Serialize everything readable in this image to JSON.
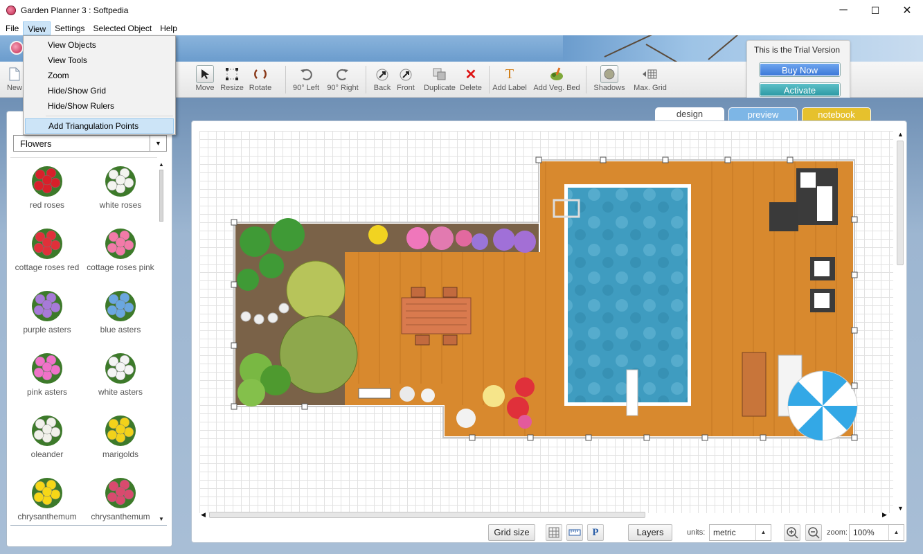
{
  "window": {
    "title": "Garden Planner 3 : Softpedia",
    "minimize": "─",
    "maximize": "☐",
    "close": "✕"
  },
  "menubar": {
    "items": [
      "File",
      "View",
      "Settings",
      "Selected Object",
      "Help"
    ],
    "active": "View"
  },
  "view_menu": {
    "items": [
      "View Objects",
      "View Tools",
      "Zoom",
      "Hide/Show Grid",
      "Hide/Show Rulers",
      "Add Triangulation Points"
    ],
    "highlighted": "Add Triangulation Points"
  },
  "toolbar": {
    "items": [
      "New",
      "Move",
      "Resize",
      "Rotate",
      "90° Left",
      "90° Right",
      "Back",
      "Front",
      "Duplicate",
      "Delete",
      "Add Label",
      "Add Veg. Bed",
      "Shadows",
      "Max. Grid"
    ]
  },
  "trial": {
    "text": "This is the Trial Version",
    "buy_label": "Buy Now",
    "activate_label": "Activate"
  },
  "tabs": [
    "design",
    "preview",
    "notebook"
  ],
  "left_panel": {
    "category": "Flowers",
    "plants": [
      {
        "name": "red roses",
        "color": "#d8202a"
      },
      {
        "name": "white roses",
        "color": "#f4f4f0"
      },
      {
        "name": "cottage roses red",
        "color": "#e0303a"
      },
      {
        "name": "cottage roses pink",
        "color": "#f27aa8"
      },
      {
        "name": "purple asters",
        "color": "#a77ad8"
      },
      {
        "name": "blue asters",
        "color": "#6aa7e0"
      },
      {
        "name": "pink asters",
        "color": "#f072c8"
      },
      {
        "name": "white asters",
        "color": "#f4f4f4"
      },
      {
        "name": "oleander",
        "color": "#f1f1ea"
      },
      {
        "name": "marigolds",
        "color": "#f2d21a"
      },
      {
        "name": "chrysanthemum",
        "color": "#f6d717"
      },
      {
        "name": "chrysanthemum",
        "color": "#d94a6e"
      }
    ]
  },
  "bottom_bar": {
    "grid_size_label": "Grid size",
    "layers_label": "Layers",
    "units_label": "units:",
    "units_value": "metric",
    "zoom_label": "zoom:",
    "zoom_value": "100%",
    "p_label": "P"
  },
  "colors": {
    "deck": "#d8892e",
    "pool": "#3f9cc0",
    "soil": "#7a6248",
    "buy_button": "#3c78d8",
    "activate_button": "#2e9aa5",
    "notebook_tab": "#e6c12d",
    "preview_tab": "#7db6e6"
  }
}
